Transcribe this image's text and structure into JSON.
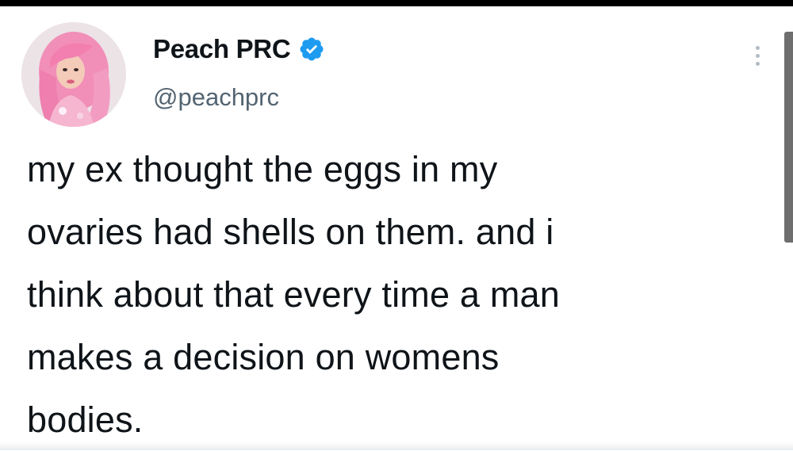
{
  "user": {
    "display_name": "Peach PRC",
    "handle": "@peachprc",
    "verified": true,
    "avatar_icon": "profile-photo"
  },
  "tweet": {
    "text": "my ex thought the eggs in my\novaries had shells on them. and i\nthink about that every time a man\nmakes a decision on womens\nbodies."
  },
  "icons": {
    "verified": "verified-badge-icon",
    "more": "more-options-icon"
  },
  "colors": {
    "name": "#0f1419",
    "handle": "#536471",
    "verified": "#1d9bf0",
    "avatar_hair": "#f08bb4"
  }
}
